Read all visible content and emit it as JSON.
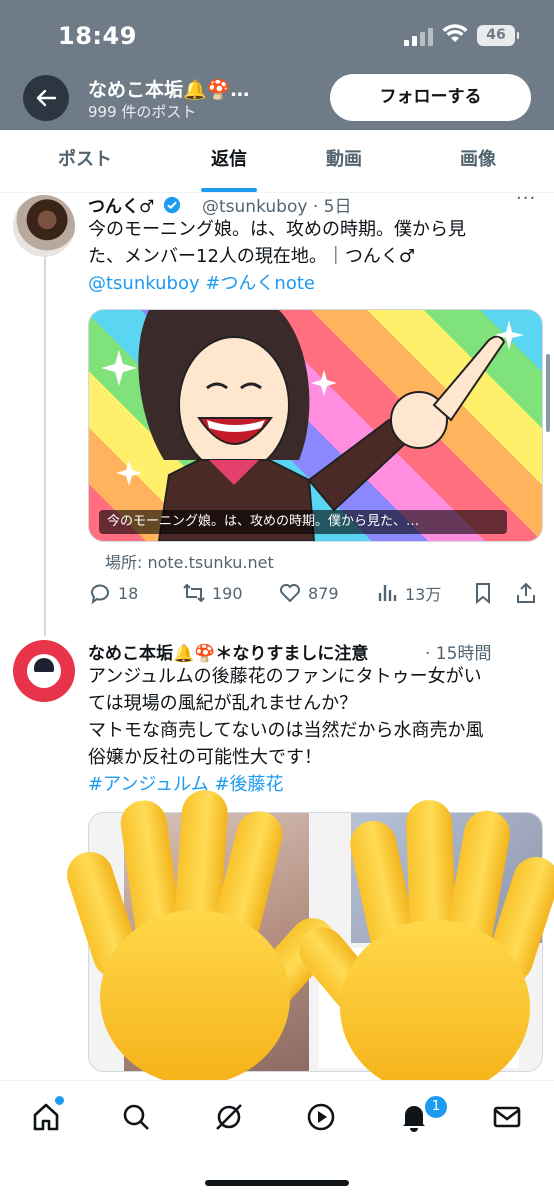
{
  "status": {
    "time": "18:49",
    "battery": "46"
  },
  "header": {
    "title": "なめこ本垢🔔🍄…",
    "post_count": "999 件のポスト",
    "follow_label": "フォローする"
  },
  "tabs": [
    {
      "label": "ポスト",
      "active": false
    },
    {
      "label": "返信",
      "active": true
    },
    {
      "label": "動画",
      "active": false
    },
    {
      "label": "画像",
      "active": false
    }
  ],
  "tweet1": {
    "name": "つんく♂",
    "handle": "@tsunkuboy · 5日",
    "text_line1": "今のモーニング娘。は、攻めの時期。僕から見",
    "text_line2": "た、メンバー12人の現在地。｜つんく♂",
    "text_links": "@tsunkuboy #つんくnote",
    "card_caption": "今のモーニング娘。は、攻めの時期。僕から見た、…",
    "card_source": "場所: note.tsunku.net",
    "replies": "18",
    "reposts": "190",
    "likes": "879",
    "views": "13万"
  },
  "tweet2": {
    "name": "なめこ本垢🔔🍄＊なりすましに注意",
    "time": "· 15時間",
    "line1": "アンジュルムの後藤花のファンにタトゥー女がい",
    "line2": "ては現場の風紀が乱れませんか？",
    "line3": "マトモな商売してないのは当然だから水商売か風",
    "line4": "俗嬢か反社の可能性大です！",
    "hashtags": "#アンジュルム #後藤花"
  },
  "nav": {
    "notification_count": "1"
  },
  "colors": {
    "accent": "#1d9bf0",
    "header_bg": "#6f7c88"
  }
}
